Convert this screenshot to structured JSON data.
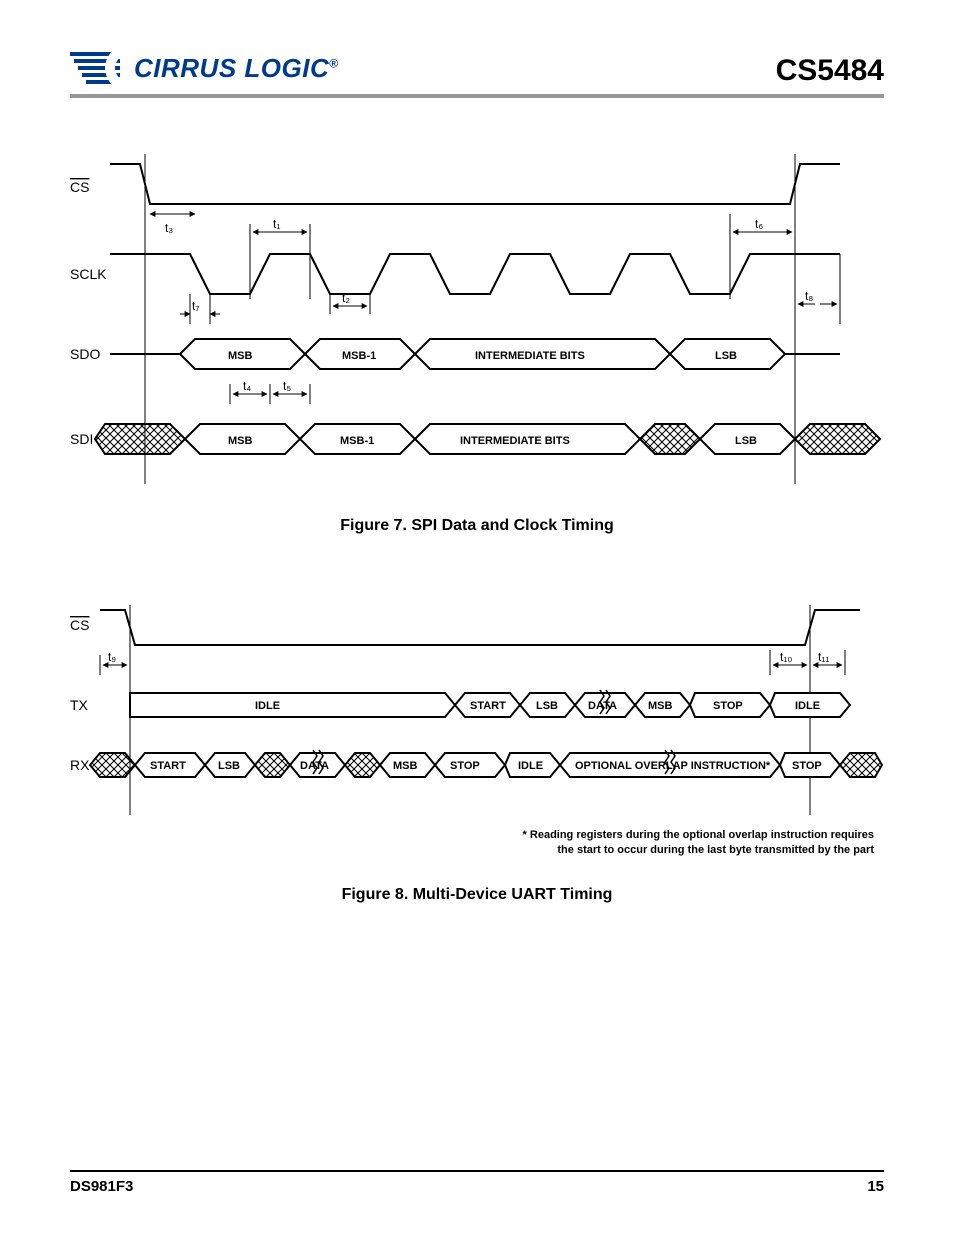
{
  "header": {
    "company": "CIRRUS LOGIC",
    "reg_mark": "®",
    "part_number": "CS5484"
  },
  "figure7": {
    "caption": "Figure 7.  SPI Data and Clock Timing",
    "signals": {
      "cs": "CS",
      "sclk": "SCLK",
      "sdo": "SDO",
      "sdi": "SDI"
    },
    "timing_labels": {
      "t1": "t₁",
      "t2": "t₂",
      "t3": "t₃",
      "t4": "t₄",
      "t5": "t₅",
      "t6": "t₆",
      "t7": "t₇",
      "t8": "t₈"
    },
    "bits": {
      "msb": "MSB",
      "msb1": "MSB-1",
      "inter": "INTERMEDIATE BITS",
      "lsb": "LSB"
    }
  },
  "figure8": {
    "caption": "Figure 8.  Multi-Device UART Timing",
    "signals": {
      "cs": "CS",
      "tx": "TX",
      "rx": "RX"
    },
    "timing_labels": {
      "t9": "t₉",
      "t10": "t₁₀",
      "t11": "t₁₁"
    },
    "fields": {
      "idle": "IDLE",
      "start": "START",
      "lsb": "LSB",
      "data": "DATA",
      "msb": "MSB",
      "stop": "STOP",
      "overlap": "OPTIONAL OVERLAP INSTRUCTION*"
    },
    "footnote_l1": "* Reading registers during the optional overlap instruction requires",
    "footnote_l2": "the start to occur during the last byte transmitted by the part"
  },
  "footer": {
    "doc": "DS981F3",
    "page": "15"
  }
}
